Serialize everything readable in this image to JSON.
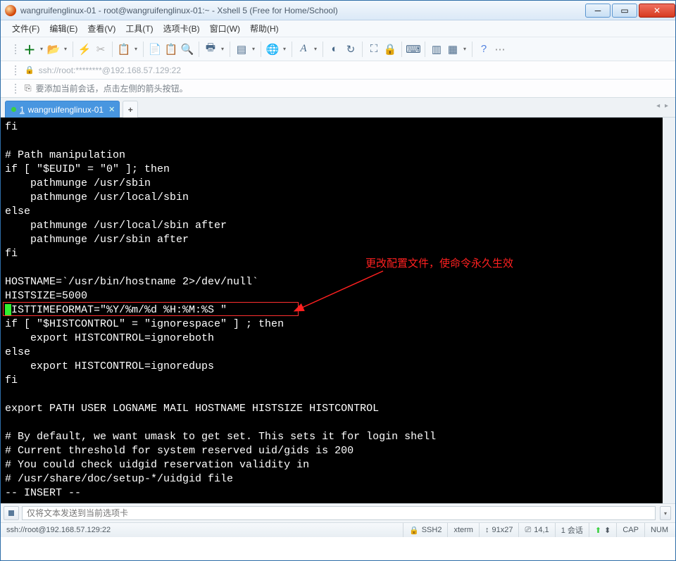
{
  "window": {
    "title": "wangruifenglinux-01 - root@wangruifenglinux-01:~ - Xshell 5 (Free for Home/School)"
  },
  "menu": {
    "items": [
      "文件(F)",
      "编辑(E)",
      "查看(V)",
      "工具(T)",
      "选项卡(B)",
      "窗口(W)",
      "帮助(H)"
    ]
  },
  "address": {
    "text": "ssh://root:********@192.168.57.129:22"
  },
  "message": {
    "text": "要添加当前会话，点击左侧的箭头按钮。"
  },
  "tabs": {
    "active": {
      "num": "1",
      "label": "wangruifenglinux-01"
    }
  },
  "terminal": {
    "lines": [
      "fi",
      "",
      "# Path manipulation",
      "if [ \"$EUID\" = \"0\" ]; then",
      "    pathmunge /usr/sbin",
      "    pathmunge /usr/local/sbin",
      "else",
      "    pathmunge /usr/local/sbin after",
      "    pathmunge /usr/sbin after",
      "fi",
      "",
      "HOSTNAME=`/usr/bin/hostname 2>/dev/null`",
      "HISTSIZE=5000"
    ],
    "highlight_first": " ",
    "highlight_line": "HISTTIMEFORMAT=\"%Y/%m/%d %H:%M:%S \"",
    "lines2": [
      "if [ \"$HISTCONTROL\" = \"ignorespace\" ] ; then",
      "    export HISTCONTROL=ignoreboth",
      "else",
      "    export HISTCONTROL=ignoredups",
      "fi",
      "",
      "export PATH USER LOGNAME MAIL HOSTNAME HISTSIZE HISTCONTROL",
      "",
      "# By default, we want umask to get set. This sets it for login shell",
      "# Current threshold for system reserved uid/gids is 200",
      "# You could check uidgid reservation validity in",
      "# /usr/share/doc/setup-*/uidgid file",
      "-- INSERT --"
    ]
  },
  "annotation": {
    "text": "更改配置文件，使命令永久生效"
  },
  "input": {
    "placeholder": "仅将文本发送到当前选项卡"
  },
  "status": {
    "path": "ssh://root@192.168.57.129:22",
    "ssh": "SSH2",
    "term": "xterm",
    "size": "91x27",
    "pos": "14,1",
    "sess": "1 会话",
    "caps": "CAP",
    "num": "NUM"
  }
}
